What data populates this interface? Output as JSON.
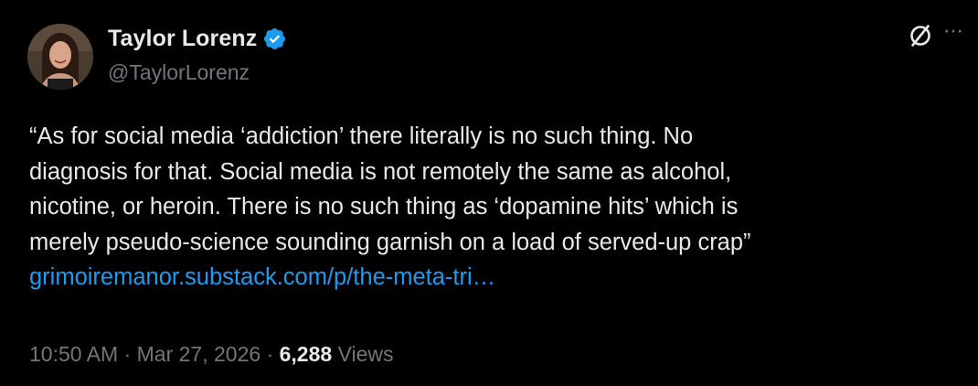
{
  "author": {
    "display_name": "Taylor Lorenz",
    "handle": "@TaylorLorenz",
    "verified": true
  },
  "icons": {
    "verified": "verified-badge-icon",
    "grok": "grok-icon",
    "more": "more-options-icon"
  },
  "tweet": {
    "lines": [
      "“As for social media ‘addiction’ there literally is no such thing. No",
      "diagnosis for that. Social media is not remotely the same as alcohol,",
      "nicotine, or heroin. There is no such thing as ‘dopamine hits’ which is",
      "merely pseudo-science sounding garnish on a load of served-up crap”"
    ],
    "link_text": "grimoiremanor.substack.com/p/the-meta-tri…"
  },
  "meta": {
    "time": "10:50 AM",
    "separator": "·",
    "date": "Mar 27, 2026",
    "views_count": "6,288",
    "views_label": "Views"
  },
  "colors": {
    "background": "#000000",
    "text": "#e7e9ea",
    "secondary": "#71767b",
    "link": "#1d9bf0",
    "verified": "#1d9bf0"
  }
}
